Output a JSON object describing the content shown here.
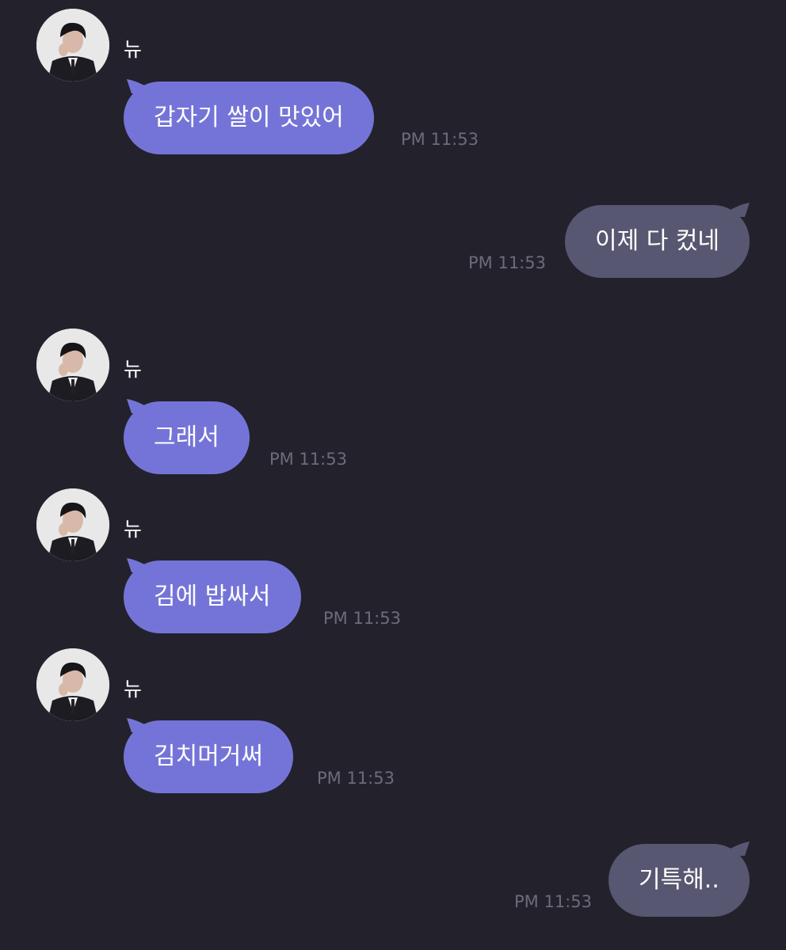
{
  "contact": {
    "name": "뉴",
    "avatar_icon": "profile-photo-icon"
  },
  "colors": {
    "background": "#23222c",
    "incoming": "#7474d8",
    "outgoing": "#585771",
    "time": "#6c6c78"
  },
  "messages": [
    {
      "direction": "in",
      "show_header": true,
      "text": "갑자기 쌀이 맛있어",
      "time": "PM 11:53"
    },
    {
      "direction": "out",
      "show_header": false,
      "text": "이제 다 컸네",
      "time": "PM 11:53"
    },
    {
      "direction": "in",
      "show_header": true,
      "text": "그래서",
      "time": "PM 11:53"
    },
    {
      "direction": "in",
      "show_header": true,
      "text": "김에 밥싸서",
      "time": "PM 11:53"
    },
    {
      "direction": "in",
      "show_header": true,
      "text": "김치머거써",
      "time": "PM 11:53"
    },
    {
      "direction": "out",
      "show_header": false,
      "text": "기특해..",
      "time": "PM 11:53"
    }
  ]
}
